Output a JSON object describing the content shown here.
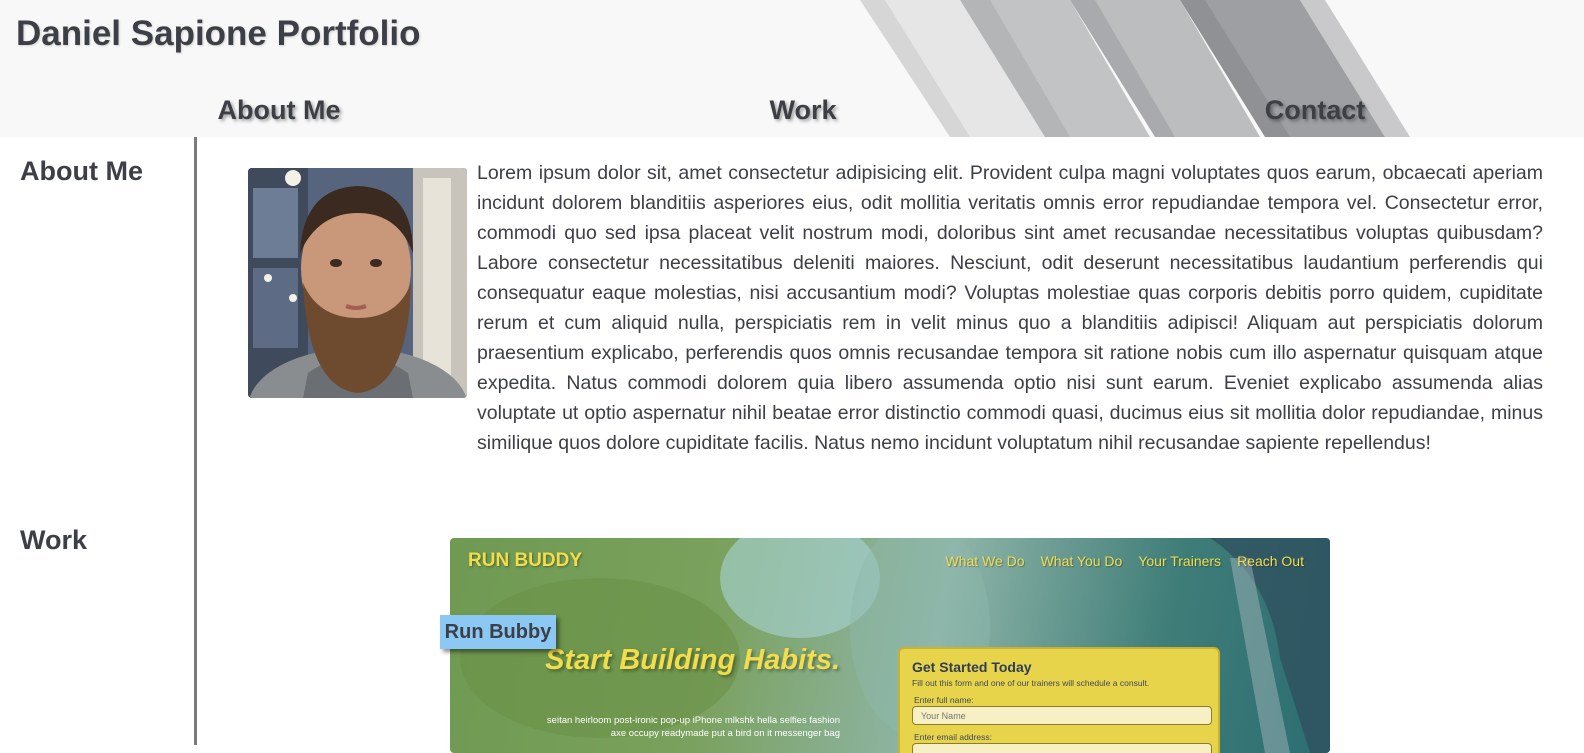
{
  "header": {
    "title": "Daniel Sapione Portfolio",
    "nav": [
      "About Me",
      "Work",
      "Contact"
    ]
  },
  "about": {
    "heading": "About Me",
    "photo_icon": "profile-photo",
    "bio": "Lorem ipsum dolor sit, amet consectetur adipisicing elit. Provident culpa magni voluptates quos earum, obcaecati aperiam incidunt dolorem blanditiis asperiores eius, odit mollitia veritatis omnis error repudiandae tempora vel. Consectetur error, commodi quo sed ipsa placeat velit nostrum modi, doloribus sint amet recusandae necessitatibus voluptas quibusdam? Labore consectetur necessitatibus deleniti maiores. Nesciunt, odit deserunt necessitatibus laudantium perferendis qui consequatur eaque molestias, nisi accusantium modi? Voluptas molestiae quas corporis debitis porro quidem, cupiditate rerum et cum aliquid nulla, perspiciatis rem in velit minus quo a blanditiis adipisci! Aliquam aut perspiciatis dolorum praesentium explicabo, perferendis quos omnis recusandae tempora sit ratione nobis cum illo aspernatur quisquam atque expedita. Natus commodi dolorem quia libero assumenda optio nisi sunt earum. Eveniet explicabo assumenda alias voluptate ut optio aspernatur nihil beatae error distinctio commodi quasi, ducimus eius sit mollitia dolor repudiandae, minus similique quos dolore cupiditate facilis. Natus nemo incidunt voluptatum nihil recusandae sapiente repellendus!"
  },
  "work": {
    "heading": "Work",
    "project": {
      "badge": "Run Bubby",
      "brand": "RUN BUDDY",
      "nav": [
        "What We Do",
        "What You Do",
        "Your Trainers",
        "Reach Out"
      ],
      "hero": "Start Building Habits.",
      "copy": "seitan heirloom post-ironic pop-up iPhone mlkshk hella selfies fashion axe occupy readymade put a bird on it messenger bag",
      "form": {
        "title": "Get Started Today",
        "subtitle": "Fill out this form and one of our trainers will schedule a consult.",
        "name_label": "Enter full name:",
        "name_placeholder": "Your Name",
        "email_label": "Enter email address:"
      }
    }
  },
  "colors": {
    "text": "#3d3f46",
    "header_bg": "#f8f8f8",
    "accent_yellow": "#f2dd4c",
    "badge_blue": "#8cc8f4"
  }
}
